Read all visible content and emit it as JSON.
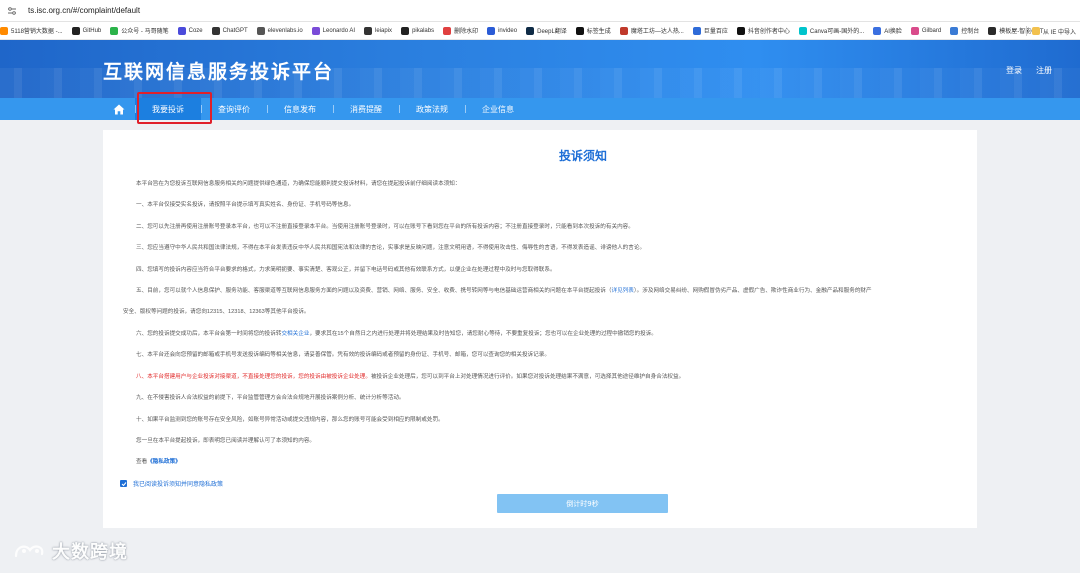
{
  "browser": {
    "url": "ts.isc.org.cn/#/complaint/default",
    "bookmarks": [
      {
        "label": "5118营销大数据 -...",
        "color": "#ff8a00"
      },
      {
        "label": "GitHub",
        "color": "#222222"
      },
      {
        "label": "公众号 - 马哥随笔",
        "color": "#2bb34a"
      },
      {
        "label": "Coze",
        "color": "#4b4bdb"
      },
      {
        "label": "ChatGPT",
        "color": "#333333"
      },
      {
        "label": "elevenlabs.io",
        "color": "#555555"
      },
      {
        "label": "Leonardo AI",
        "color": "#7a4bd8"
      },
      {
        "label": "leiapix",
        "color": "#333333"
      },
      {
        "label": "pikalabs",
        "color": "#222222"
      },
      {
        "label": "删除水印",
        "color": "#e04040"
      },
      {
        "label": "invideo",
        "color": "#2a5bd6"
      },
      {
        "label": "DeepL翻译",
        "color": "#0f2b46"
      },
      {
        "label": "标签生成",
        "color": "#111111"
      },
      {
        "label": "魔塔工坊—达人热...",
        "color": "#c0392b"
      },
      {
        "label": "巨量百应",
        "color": "#2f6bd8"
      },
      {
        "label": "抖音创作者中心",
        "color": "#111111"
      },
      {
        "label": "Canva可画-国外的...",
        "color": "#00c4cc"
      },
      {
        "label": "AI换脸",
        "color": "#3b6fe0"
      },
      {
        "label": "Gilbard",
        "color": "#d94b8b"
      },
      {
        "label": "控制台",
        "color": "#3a7bd5"
      },
      {
        "label": "模板屋-智能GPT",
        "color": "#2a2a2a"
      }
    ],
    "bookmarks_more": "从 IE 中导入"
  },
  "header": {
    "site_title": "互联网信息服务投诉平台",
    "login": "登录",
    "register": "注册"
  },
  "nav": {
    "items": [
      "我要投诉",
      "查询评价",
      "信息发布",
      "消费提醒",
      "政策法规",
      "企业信息"
    ]
  },
  "notice": {
    "title": "投诉须知",
    "intro": "本平台旨在为您投诉互联网信息服务相关的问题提供绿色通道，为确保您能顺利提交投诉材料，请您在提起投诉前仔细阅读本须知：",
    "p1": "一、本平台仅接受实名投诉，请按照平台提示填写真实姓名、身份证、手机号码等信息。",
    "p2": "二、您可以先注册再使用注册账号登录本平台，也可以不注册直接登录本平台。当使用注册账号登录时，可以在账号下看到您在平台的所有投诉内容；不注册直接登录时，只能看到本次投诉的有关内容。",
    "p3": "三、您应当遵守中华人民共和国法律法规，不得在本平台发表违反中华人民共和国宪法和法律的言论，实事求是反映问题，注意文明用语，不得使用攻击性、侮辱性的言语，不得发表造谣、诽谤他人的言论。",
    "p4": "四、您填写的投诉内容应当符合平台要求的格式，力求简明扼要、事实清楚、客观公正，并留下电话号码或其他有效联系方式，以便企业在处理过程中及时与您取得联系。",
    "p5a": "五、目前，您可以就个人信息保护、服务功能、客服渠道等互联网信息服务方面的问题以及资费、营销、网络、服务、安全、收费、携号转网等与电信基础运营商相关的问题在本平台提起投诉（",
    "p5_link": "详见列表",
    "p5b": "）。涉及网络交易纠纷、网购假冒伪劣产品、虚假广告、欺诈性商业行为、金融产品和服务的财产",
    "p5c": "安全、版权等问题的投诉，请您向12315、12318、12363等其他平台投诉。",
    "p6a": "六、您的投诉提交成功后，本平台会第一时间将您的投诉转",
    "p6_link": "交相关企业",
    "p6b": "，要求其在15个自然日之内进行处理并将处理结果及时告知您，请您耐心等待，不要重复投诉；您也可以在企业处理的过程中撤销您的投诉。",
    "p7": "七、本平台还会向您预留的邮箱或手机号发送投诉编码等相关信息，请妥善保管。凭有效的投诉编码或者预留的身份证、手机号、邮箱，您可以查询您的相关投诉记录。",
    "p8_red": "八、本平台搭建用户与企业投诉对接渠道，不直接处理您的投诉，您的投诉由被投诉企业处理。",
    "p8b": "被投诉企业处理后，您可以到平台上对处理情况进行评价。如果您对投诉处理结果不满意，可选择其他途径维护自身合法权益。",
    "p9": "九、在不侵害投诉人合法权益的前提下，平台监管管理方会合法合规地开展投诉案例分析、统计分析等活动。",
    "p10": "十、如果平台监测到您的账号存在安全风险，如账号异常活动或提交违规内容，那么您的账号可能会受到相应的限制或处罚。",
    "p11": "您一旦在本平台提起投诉，即表明您已阅读并理解认可了本须知的内容。",
    "view_prefix": "查看",
    "privacy_link": "《隐私政策》",
    "agree_label": "我已阅读投诉须知并同意隐私政策",
    "countdown_label": "倒计时9秒"
  },
  "watermark": {
    "text": "大数跨境"
  },
  "colors": {
    "brand_blue": "#2b80e0",
    "nav_blue": "#3597ee",
    "link_blue": "#1f6fd6",
    "warning_red": "#e12a2a",
    "button_disabled": "#82c3f3"
  }
}
